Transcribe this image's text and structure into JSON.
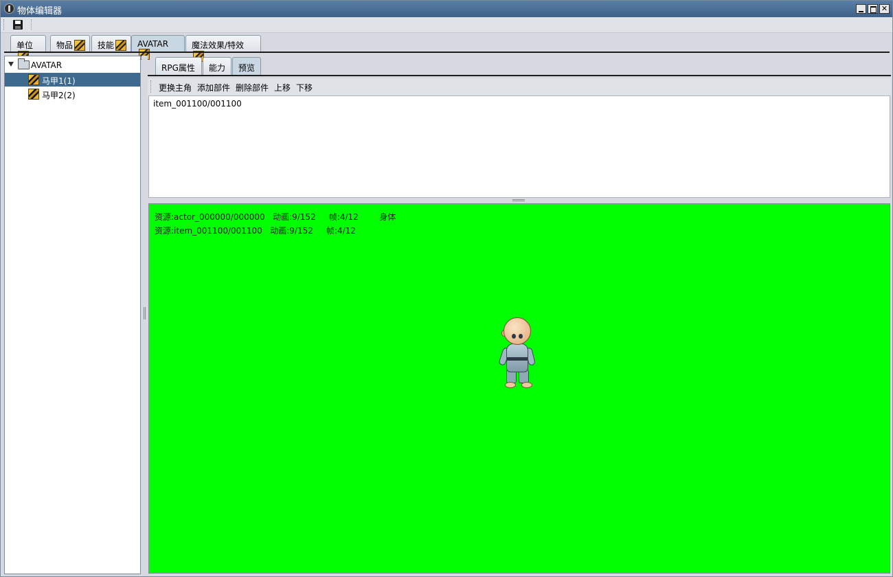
{
  "window": {
    "title": "物体编辑器",
    "controls": {
      "minimize": "_",
      "maximize": "□",
      "close": "✕"
    }
  },
  "toolbar": {
    "save_icon": "save-disk-icon"
  },
  "main_tabs": [
    {
      "label": "单位",
      "icon": "unit-icon",
      "active": false
    },
    {
      "label": "物品",
      "icon": "item-icon",
      "active": false
    },
    {
      "label": "技能",
      "icon": "skill-icon",
      "active": false
    },
    {
      "label": "AVATAR",
      "icon": "avatar-icon",
      "active": true
    },
    {
      "label": "魔法效果/特效",
      "icon": "magic-effect-icon",
      "active": false
    }
  ],
  "tree": {
    "root": {
      "label": "AVATAR",
      "icon": "folder-icon",
      "expanded": true
    },
    "items": [
      {
        "label": "马甲1(1)",
        "icon": "avatar-item-icon",
        "selected": true
      },
      {
        "label": "马甲2(2)",
        "icon": "avatar-item-icon",
        "selected": false
      }
    ]
  },
  "sub_tabs": [
    {
      "label": "RPG属性",
      "active": false
    },
    {
      "label": "能力",
      "active": false
    },
    {
      "label": "预览",
      "active": true
    }
  ],
  "actions": [
    "更换主角",
    "添加部件",
    "删除部件",
    "上移",
    "下移"
  ],
  "part_list": {
    "lines": [
      "item_001100/001100"
    ]
  },
  "preview": {
    "background": "#00ff00",
    "overlay": [
      "资源:actor_000000/000000   动画:9/152     帧:4/12        身体",
      "资源:item_001100/001100   动画:9/152     帧:4/12"
    ],
    "sprite": "monk-character-sprite"
  },
  "colors": {
    "titlebar": "#3d6189",
    "selection": "#3d6a8e",
    "preview_bg": "#00ff00"
  }
}
